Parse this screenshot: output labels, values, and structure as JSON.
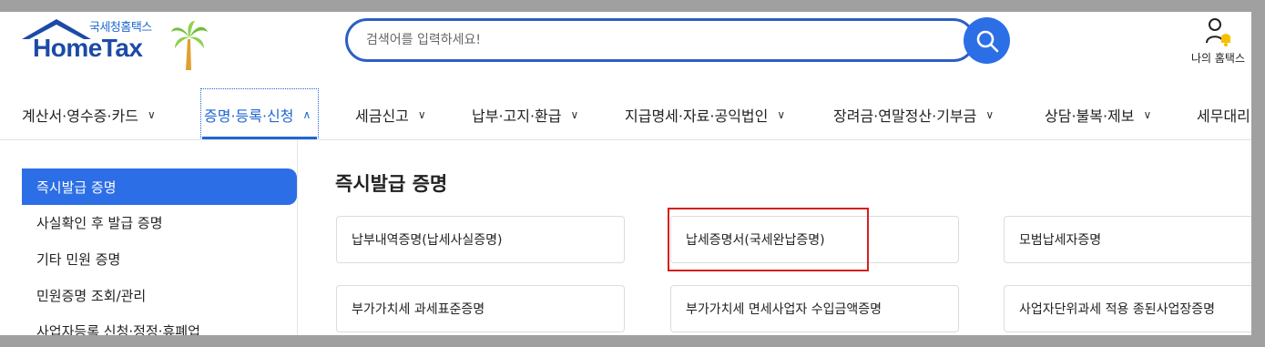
{
  "header": {
    "logo_sub": "국세청홈택스",
    "logo_main": "HomeTax",
    "search_placeholder": "검색어를 입력하세요!",
    "my_hometax": "나의 홈택스"
  },
  "nav": {
    "items": [
      {
        "label": "계산서·영수증·카드"
      },
      {
        "label": "증명·등록·신청"
      },
      {
        "label": "세금신고"
      },
      {
        "label": "납부·고지·환급"
      },
      {
        "label": "지급명세·자료·공익법인"
      },
      {
        "label": "장려금·연말정산·기부금"
      },
      {
        "label": "상담·불복·제보"
      },
      {
        "label": "세무대리·납"
      }
    ]
  },
  "sidebar": {
    "items": [
      {
        "label": "즉시발급 증명"
      },
      {
        "label": "사실확인 후 발급 증명"
      },
      {
        "label": "기타 민원 증명"
      },
      {
        "label": "민원증명 조회/관리"
      },
      {
        "label": "사업자등록 신청·정정·휴폐업"
      }
    ]
  },
  "main": {
    "title": "즉시발급 증명",
    "cards": [
      {
        "label": "납부내역증명(납세사실증명)"
      },
      {
        "label": "납세증명서(국세완납증명)"
      },
      {
        "label": "모범납세자증명"
      },
      {
        "label": "부가가치세 과세표준증명"
      },
      {
        "label": "부가가치세 면세사업자 수입금액증명"
      },
      {
        "label": "사업자단위과세 적용 종된사업장증명"
      }
    ]
  },
  "colors": {
    "accent": "#2c6ee6",
    "brand": "#1c4ba6",
    "highlight": "#d42020"
  }
}
